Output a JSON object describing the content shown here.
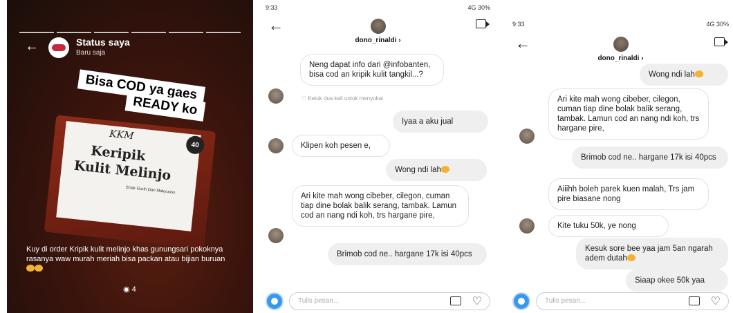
{
  "status": {
    "title": "Status saya",
    "subtitle": "Baru saja",
    "sticker_line1": "Bisa COD ya gaes",
    "sticker_line2": "READY ko",
    "brand": "KKM",
    "product_line1": "Keripik",
    "product_line2": "Kulit Melinjo",
    "tagline": "Enak Gurih Dan Makyuuss",
    "weight": "40",
    "caption": "Kuy di order Kripik kulit melinjo khas gunungsari pokoknya rasanya waw murah meriah bisa packan atau bijian buruan",
    "views": "4"
  },
  "chat1": {
    "time": "9:33",
    "system": "4G 30%",
    "contact": "dono_rinaldi ›",
    "placeholder": "Tulis pesan...",
    "like_hint": "Ketuk dua kali untuk menyukai",
    "messages": [
      {
        "from": "me",
        "text": "Neng dapat info dari @infobanten, bisa cod an kripik kulit tangkil...?"
      },
      {
        "from": "me",
        "text": "Iyaa a aku jual"
      },
      {
        "from": "them",
        "text": "Klipen koh pesen e,"
      },
      {
        "from": "me",
        "text": "Wong ndi lah"
      },
      {
        "from": "them",
        "text": "Ari kite mah wong cibeber, cilegon, cuman tiap dine bolak balik serang, tambak. Lamun cod an nang ndi koh, trs hargane pire,"
      },
      {
        "from": "me",
        "text": "Brimob cod ne.. hargane 17k isi 40pcs"
      }
    ]
  },
  "chat2": {
    "time": "9:33",
    "system": "4G 30%",
    "contact": "dono_rinaldi ›",
    "placeholder": "Tulis pesan...",
    "messages": [
      {
        "from": "me",
        "text": "Wong ndi lah"
      },
      {
        "from": "them",
        "text": "Ari kite mah wong cibeber, cilegon, cuman tiap dine bolak balik serang, tambak. Lamun cod an nang ndi koh, trs hargane pire,"
      },
      {
        "from": "me",
        "text": "Brimob cod ne.. hargane 17k isi 40pcs"
      },
      {
        "from": "them",
        "text": "Aiiihh boleh parek kuen malah, Trs jam pire biasane nong"
      },
      {
        "from": "them",
        "text": "Kite tuku 50k, ye nong"
      },
      {
        "from": "me",
        "text": "Kesuk sore bee yaa jam 5an ngarah adem dutah"
      },
      {
        "from": "me",
        "text": "Siaap okee 50k yaa"
      }
    ]
  }
}
